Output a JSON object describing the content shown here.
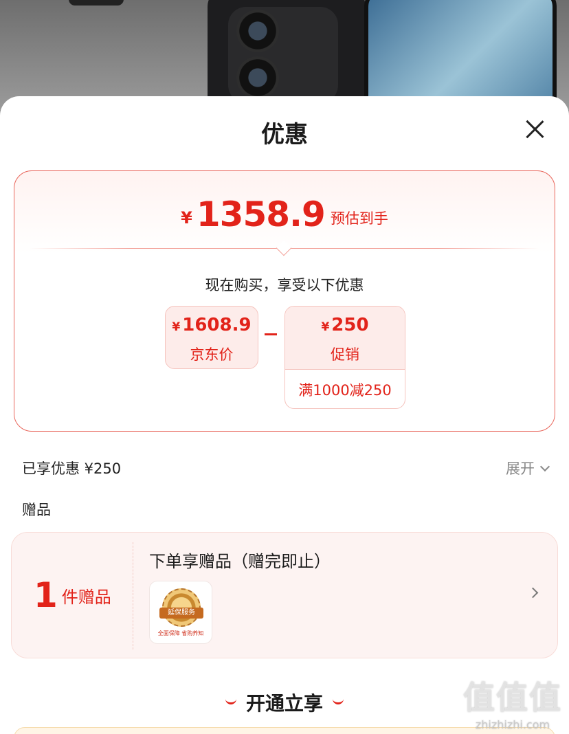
{
  "sheet": {
    "title": "优惠",
    "close_icon": "close-icon"
  },
  "price_summary": {
    "currency": "¥",
    "final_price": "1358.9",
    "final_label": "预估到手",
    "subtitle": "现在购买，享受以下优惠",
    "jd_price": {
      "currency": "¥",
      "value": "1608.9",
      "label": "京东价"
    },
    "promo": {
      "currency": "¥",
      "value": "250",
      "label": "促销",
      "rule": "满1000减250"
    }
  },
  "savings": {
    "label": "已享优惠 ¥250",
    "expand_label": "展开"
  },
  "gifts": {
    "heading": "赠品",
    "count": "1",
    "count_unit": "件赠品",
    "title": "下单享赠品（赠完即止）",
    "thumb_band": "延保服务",
    "thumb_caption": "全面保障 省购养知"
  },
  "member": {
    "title": "开通立享"
  },
  "watermark": {
    "logo": "值值值",
    "site": "zhizhizhi.com"
  },
  "colors": {
    "accent": "#e2231a",
    "card_bg": "#fdecea",
    "border": "#e8655a"
  }
}
